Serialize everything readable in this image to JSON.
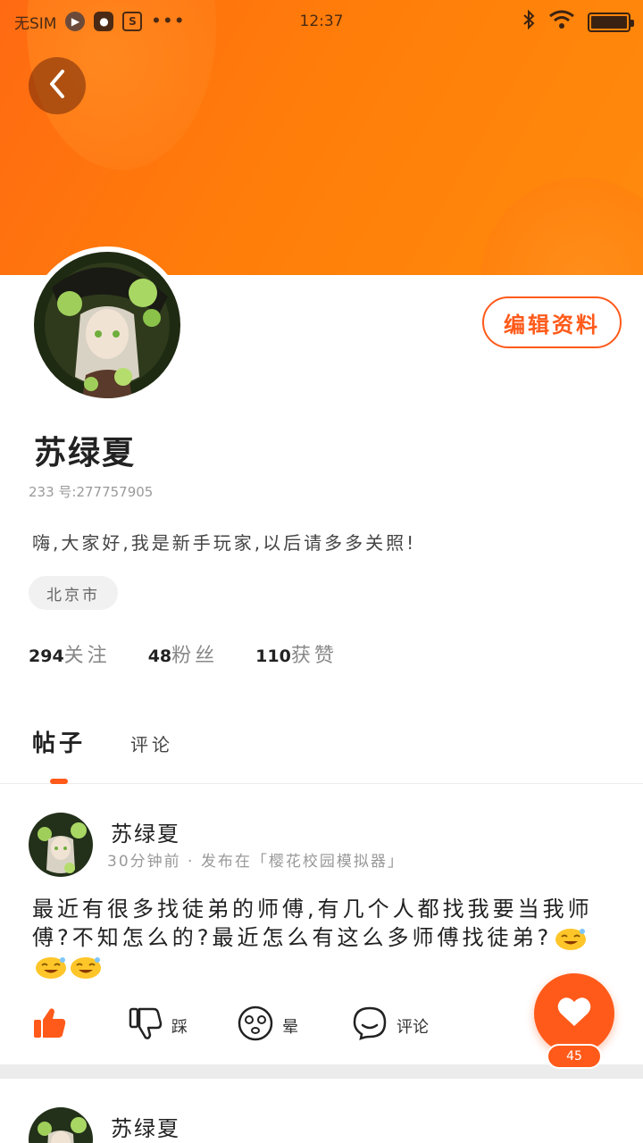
{
  "status_bar": {
    "carrier": "无SIM",
    "time": "12:37",
    "icons": [
      "play-icon",
      "app-icon",
      "s-icon",
      "more-dots-icon",
      "bluetooth-icon",
      "wifi-icon",
      "battery-icon"
    ]
  },
  "header": {
    "back_icon": "chevron-left-icon",
    "gradient_colors": [
      "#ff6a12",
      "#ff8b0c"
    ]
  },
  "profile": {
    "edit_label": "编辑资料",
    "name": "苏绿夏",
    "uid": "233 号:277757905",
    "bio": "嗨,大家好,我是新手玩家,以后请多多关照!",
    "location": "北京市",
    "stats": [
      {
        "num": "294",
        "label": "关注"
      },
      {
        "num": "48",
        "label": "粉丝"
      },
      {
        "num": "110",
        "label": "获赞"
      }
    ]
  },
  "tabs": [
    {
      "label": "帖子",
      "active": true
    },
    {
      "label": "评论",
      "active": false
    }
  ],
  "post": {
    "author": "苏绿夏",
    "meta": "30分钟前 · 发布在「樱花校园模拟器」",
    "body": "最近有很多找徒弟的师傅,有几个人都找我要当我师傅?不知怎么的?最近怎么有这么多师傅找徒弟?",
    "emoji_icon": "sweat-smile-emoji-icon",
    "emoji_count": 3,
    "actions": [
      {
        "icon": "thumbs-up-icon",
        "label": ""
      },
      {
        "icon": "thumbs-down-icon",
        "label": "踩"
      },
      {
        "icon": "dizzy-face-icon",
        "label": "晕"
      },
      {
        "icon": "comment-bubble-icon",
        "label": "评论"
      }
    ]
  },
  "post2": {
    "author": "苏绿夏"
  },
  "fab": {
    "icon": "heart-icon",
    "count": "45"
  },
  "colors": {
    "accent": "#ff5a1a",
    "like_active": "#ff5a1a"
  }
}
